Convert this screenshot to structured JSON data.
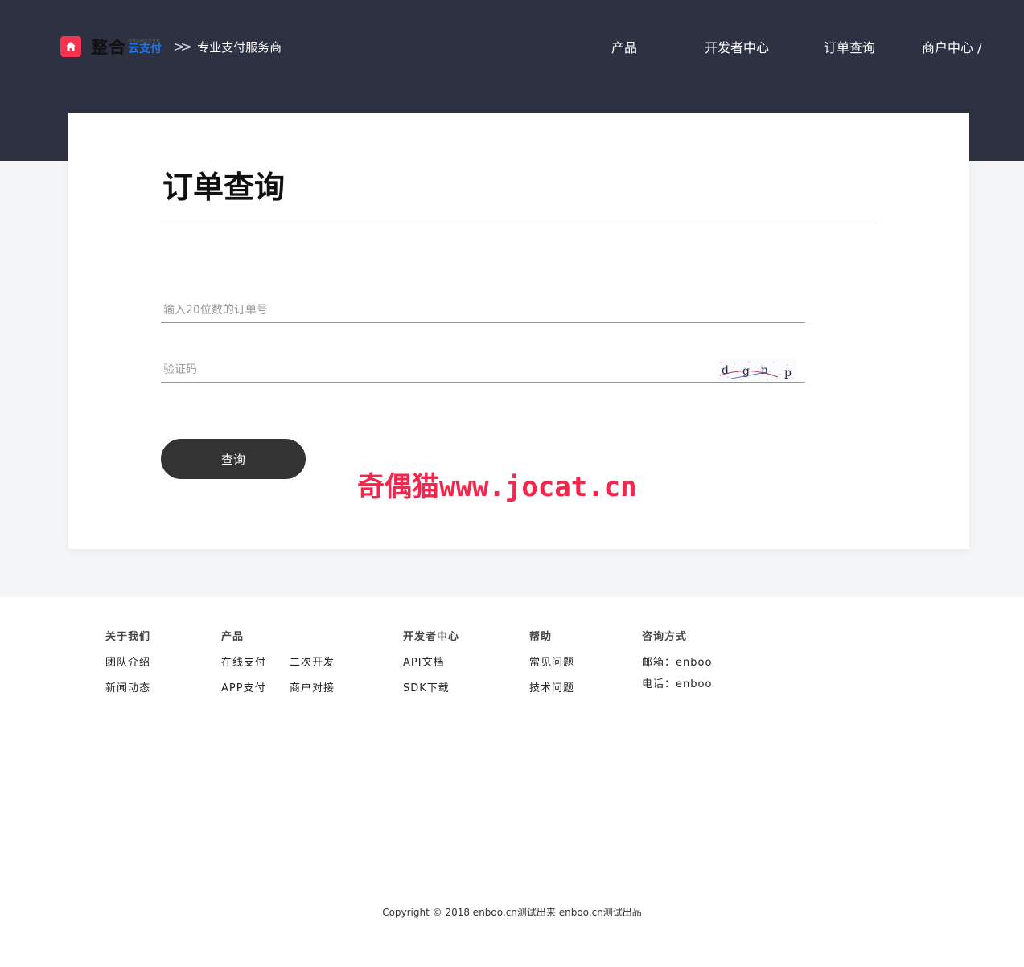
{
  "header": {
    "brand_main": "整合",
    "brand_small": "您身边的支付专家",
    "brand_blue": "云支付",
    "chevron": ">>",
    "slogan": "专业支付服务商",
    "nav": [
      "产品",
      "开发者中心",
      "订单查询",
      "商户中心 /"
    ]
  },
  "card": {
    "title": "订单查询",
    "order_placeholder": "输入20位数的订单号",
    "captcha_placeholder": "验证码",
    "captcha_text": "dgnp",
    "submit_label": "查询"
  },
  "watermark": "奇偶猫www.jocat.cn",
  "footer": {
    "about": {
      "title": "关于我们",
      "links": [
        "团队介绍",
        "新闻动态"
      ]
    },
    "product": {
      "title": "产品",
      "links": [
        [
          "在线支付",
          "二次开发"
        ],
        [
          "APP支付",
          "商户对接"
        ]
      ]
    },
    "developer": {
      "title": "开发者中心",
      "links": [
        "API文档",
        "SDK下载"
      ]
    },
    "help": {
      "title": "帮助",
      "links": [
        "常见问题",
        "技术问题"
      ]
    },
    "contact": {
      "title": "咨询方式",
      "email": "邮箱：enboo",
      "phone": "电话：enboo"
    },
    "copyright": "Copyright © 2018 enboo.cn测试出来 enboo.cn测试出品"
  },
  "colors": {
    "header_bg": "#2d3142",
    "accent": "#f5334f",
    "button_bg": "#333333",
    "watermark": "#f5254c"
  }
}
